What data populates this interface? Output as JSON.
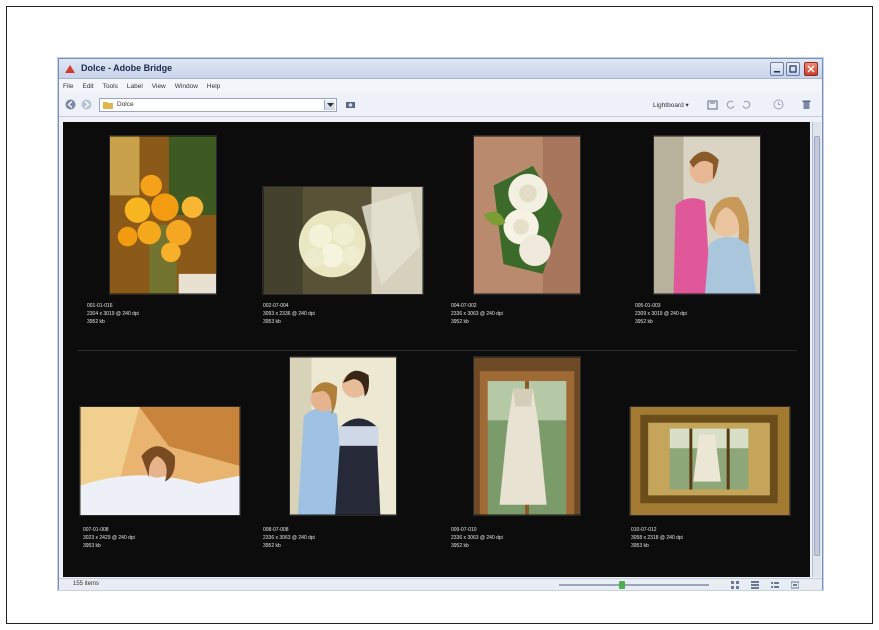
{
  "window": {
    "title": "Dolce - Adobe Bridge"
  },
  "menu": [
    "File",
    "Edit",
    "Tools",
    "Label",
    "View",
    "Window",
    "Help"
  ],
  "toolbar": {
    "path": "Dolce",
    "workspace": "Lightboard ▾"
  },
  "thumbnails": [
    {
      "name": "001-01-016",
      "dims": "2304 x 3019 @ 240 dpi",
      "size": "3952 kb"
    },
    {
      "name": "002-07-004",
      "dims": "3093 x 2336 @ 240 dpi",
      "size": "3953 kb"
    },
    {
      "name": "004-07-002",
      "dims": "2336 x 3063 @ 240 dpi",
      "size": "3952 kb"
    },
    {
      "name": "005-01-003",
      "dims": "2309 x 3019 @ 240 dpi",
      "size": "3952 kb"
    },
    {
      "name": "007-01-008",
      "dims": "3023 x 2429 @ 240 dpi",
      "size": "3953 kb"
    },
    {
      "name": "008-07-008",
      "dims": "2336 x 3063 @ 240 dpi",
      "size": "3952 kb"
    },
    {
      "name": "009-07-010",
      "dims": "2336 x 3063 @ 240 dpi",
      "size": "3952 kb"
    },
    {
      "name": "010-07-012",
      "dims": "3058 x 2318 @ 240 dpi",
      "size": "3953 kb"
    }
  ],
  "status": {
    "count": "155 items"
  },
  "colors": {
    "background": "#0c0c0c",
    "chrome": "#eef1f7",
    "titlebar": "#c9d4ea"
  }
}
